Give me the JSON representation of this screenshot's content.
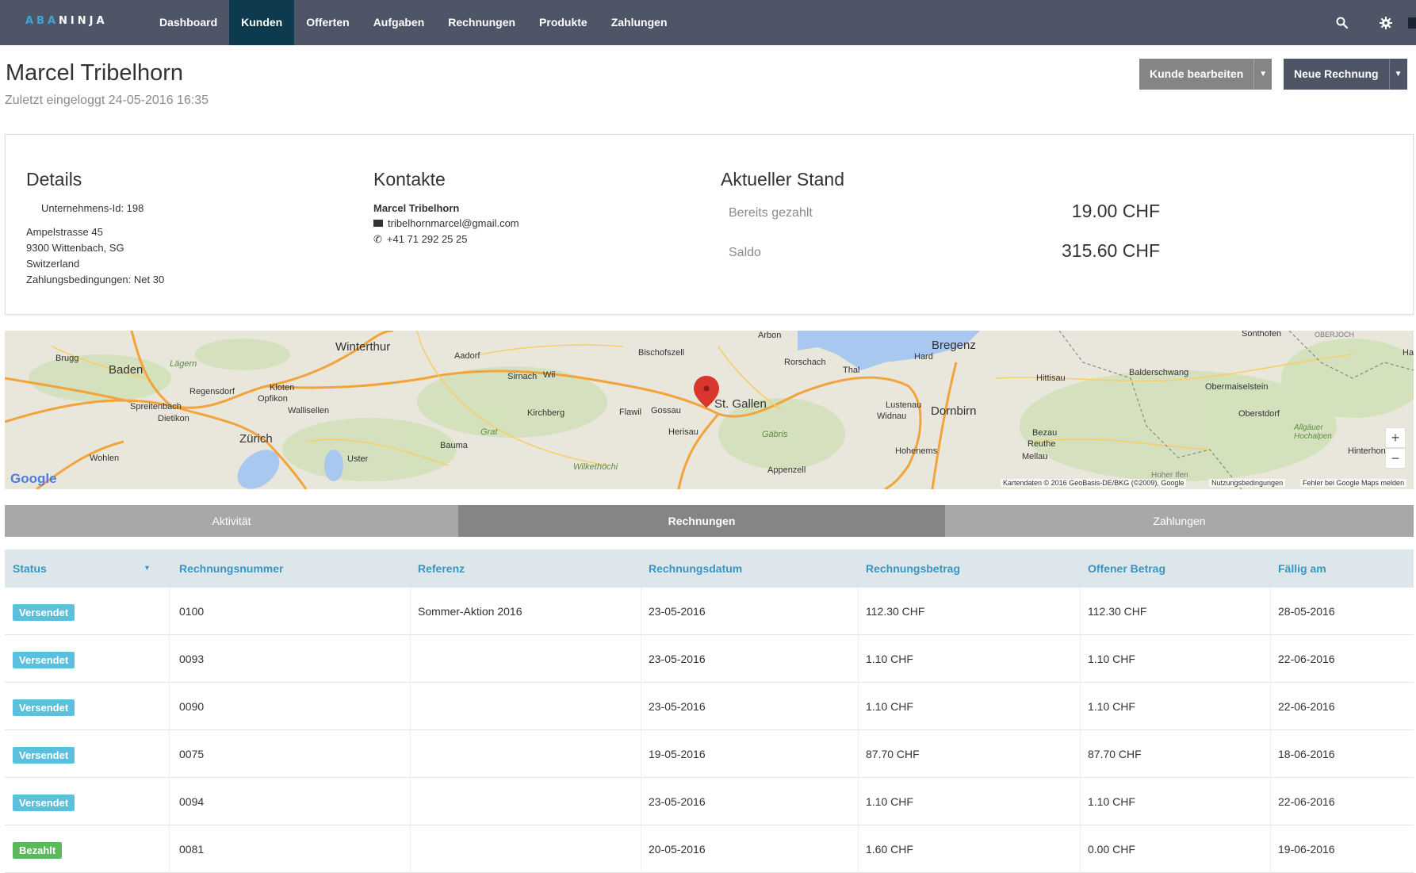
{
  "nav": {
    "logo_a": "ABA",
    "logo_b": "NINJA",
    "items": [
      "Dashboard",
      "Kunden",
      "Offerten",
      "Aufgaben",
      "Rechnungen",
      "Produkte",
      "Zahlungen"
    ],
    "active": "Kunden"
  },
  "header": {
    "title": "Marcel Tribelhorn",
    "last_login": "Zuletzt eingeloggt 24-05-2016 16:35",
    "edit_button": "Kunde bearbeiten",
    "new_invoice_button": "Neue Rechnung"
  },
  "details": {
    "title": "Details",
    "company_id": "Unternehmens-Id: 198",
    "street": "Ampelstrasse 45",
    "city": "9300 Wittenbach, SG",
    "country": "Switzerland",
    "terms": "Zahlungsbedingungen: Net 30"
  },
  "contacts": {
    "title": "Kontakte",
    "name": "Marcel Tribelhorn",
    "email": "tribelhornmarcel@gmail.com",
    "phone": "+41 71 292 25 25"
  },
  "stand": {
    "title": "Aktueller Stand",
    "paid_label": "Bereits gezahlt",
    "paid_value": "19.00 CHF",
    "balance_label": "Saldo",
    "balance_value": "315.60 CHF"
  },
  "map": {
    "labels": {
      "winterthur": "Winterthur",
      "brugg": "Brugg",
      "baden": "Baden",
      "lagern": "Lägern",
      "regensdorf": "Regensdorf",
      "kloten": "Kloten",
      "opfikon": "Opfikon",
      "spreitenbach": "Spreitenbach",
      "wallisellen": "Wallisellen",
      "dietikon": "Dietikon",
      "zurich": "Zürich",
      "wohlen": "Wohlen",
      "uster": "Uster",
      "aadorf": "Aadorf",
      "sirnach": "Sirnach",
      "wil": "Wil",
      "kirchberg": "Kirchberg",
      "bischofszell": "Bischofszell",
      "flawil": "Flawil",
      "gossau": "Gossau",
      "stgallen": "St. Gallen",
      "herisau": "Herisau",
      "bauma": "Bauma",
      "arbon": "Arbon",
      "rorschach": "Rorschach",
      "thal": "Thal",
      "bregenz": "Bregenz",
      "hard": "Hard",
      "lustenau": "Lustenau",
      "widnau": "Widnau",
      "dornbirn": "Dornbirn",
      "hohenems": "Hohenems",
      "hittisau": "Hittisau",
      "balderschwang": "Balderschwang",
      "obermaiselstein": "Obermaiselstein",
      "oberstdorf": "Oberstdorf",
      "sonthofen": "Sonthofen",
      "bezau": "Bezau",
      "reuthe": "Reuthe",
      "mellau": "Mellau",
      "hinterhornb": "Hinterhornb",
      "grat": "Grat",
      "gabris": "Gäbris",
      "wilket": "Wilkethöchi",
      "appenzell": "Appenzell",
      "allgauer": "Allgäuer Hochalpen",
      "oberjoch": "OBERJOCH",
      "hoher_ifen": "Hoher Ifen",
      "ha": "Ha"
    },
    "google": "Google",
    "attribution": "Kartendaten © 2016 GeoBasis-DE/BKG (©2009), Google",
    "terms": "Nutzungsbedingungen",
    "report": "Fehler bei Google Maps melden"
  },
  "tabs": {
    "activity": "Aktivität",
    "invoices": "Rechnungen",
    "payments": "Zahlungen"
  },
  "table": {
    "columns": [
      "Status",
      "Rechnungsnummer",
      "Referenz",
      "Rechnungsdatum",
      "Rechnungsbetrag",
      "Offener Betrag",
      "Fällig am"
    ],
    "rows": [
      {
        "status": "Versendet",
        "number": "0100",
        "reference": "Sommer-Aktion 2016",
        "date": "23-05-2016",
        "amount": "112.30 CHF",
        "open": "112.30 CHF",
        "due": "28-05-2016"
      },
      {
        "status": "Versendet",
        "number": "0093",
        "reference": "",
        "date": "23-05-2016",
        "amount": "1.10 CHF",
        "open": "1.10 CHF",
        "due": "22-06-2016"
      },
      {
        "status": "Versendet",
        "number": "0090",
        "reference": "",
        "date": "23-05-2016",
        "amount": "1.10 CHF",
        "open": "1.10 CHF",
        "due": "22-06-2016"
      },
      {
        "status": "Versendet",
        "number": "0075",
        "reference": "",
        "date": "19-05-2016",
        "amount": "87.70 CHF",
        "open": "87.70 CHF",
        "due": "18-06-2016"
      },
      {
        "status": "Versendet",
        "number": "0094",
        "reference": "",
        "date": "23-05-2016",
        "amount": "1.10 CHF",
        "open": "1.10 CHF",
        "due": "22-06-2016"
      },
      {
        "status": "Bezahlt",
        "number": "0081",
        "reference": "",
        "date": "20-05-2016",
        "amount": "1.60 CHF",
        "open": "0.00 CHF",
        "due": "19-06-2016"
      }
    ]
  },
  "colors": {
    "versendet": "#5bc0de",
    "bezahlt": "#5cb85c",
    "nav_bg": "#4e5567",
    "nav_active": "#0d3a4e",
    "header_text": "#3796c1"
  }
}
